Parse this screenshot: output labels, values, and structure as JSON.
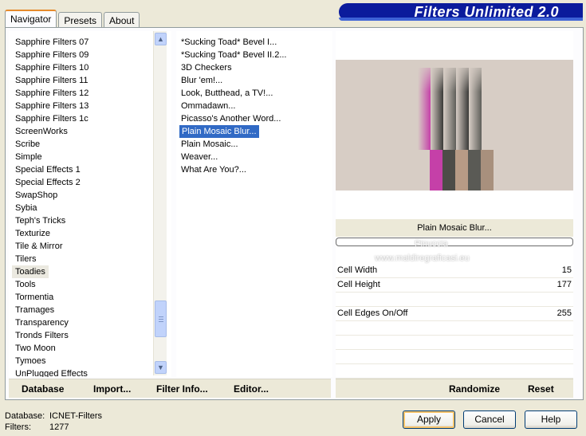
{
  "tabs": [
    "Navigator",
    "Presets",
    "About"
  ],
  "banner_title": "Filters Unlimited 2.0",
  "categories": [
    "Sapphire Filters 07",
    "Sapphire Filters 09",
    "Sapphire Filters 10",
    "Sapphire Filters 11",
    "Sapphire Filters 12",
    "Sapphire Filters 13",
    "Sapphire Filters 1c",
    "ScreenWorks",
    "Scribe",
    "Simple",
    "Special Effects 1",
    "Special Effects 2",
    "SwapShop",
    "Sybia",
    "Teph's Tricks",
    "Texturize",
    "Tile & Mirror",
    "Tilers",
    "Toadies",
    "Tools",
    "Tormentia",
    "Tramages",
    "Transparency",
    "Tronds Filters",
    "Two Moon",
    "Tymoes",
    "UnPlugged Effects"
  ],
  "selected_category": "Toadies",
  "filters": [
    "*Sucking Toad*  Bevel I...",
    "*Sucking Toad*  Bevel II.2...",
    "3D Checkers",
    "Blur 'em!...",
    "Look, Butthead, a TV!...",
    "Ommadawn...",
    "Picasso's Another Word...",
    "Plain Mosaic Blur...",
    "Plain Mosaic...",
    "Weaver...",
    "What Are You?..."
  ],
  "selected_filter": "Plain Mosaic Blur...",
  "preview": {
    "filter_name": "Plain Mosaic Blur..."
  },
  "params": [
    {
      "name": "Cell Width",
      "value": "15"
    },
    {
      "name": "Cell Height",
      "value": "177"
    },
    {
      "name": "",
      "value": ""
    },
    {
      "name": "Cell Edges On/Off",
      "value": "255"
    }
  ],
  "watermark": [
    "Pinuccia",
    "www.maldiregraficasi.eu"
  ],
  "left_buttons": [
    "Database",
    "Import...",
    "Filter Info...",
    "Editor..."
  ],
  "right_buttons": [
    "Randomize",
    "Reset"
  ],
  "footer": {
    "database_label": "Database:",
    "database_value": "ICNET-Filters",
    "filters_label": "Filters:",
    "filters_value": "1277"
  },
  "dialog_buttons": {
    "apply": "Apply",
    "cancel": "Cancel",
    "help": "Help"
  }
}
